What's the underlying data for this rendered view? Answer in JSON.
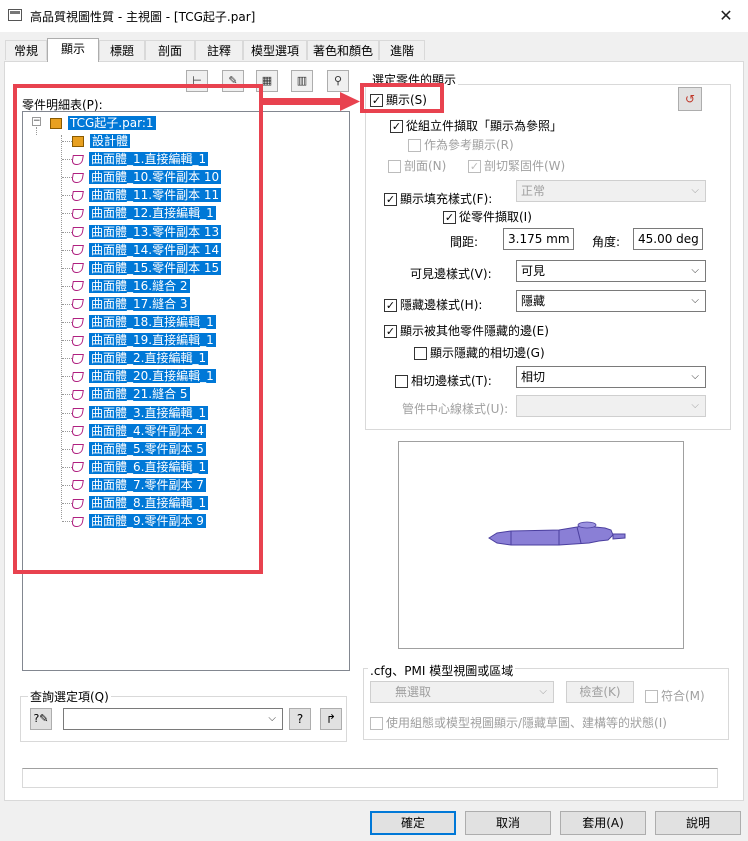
{
  "window": {
    "title": "高品質視圖性質 - 主視圖 - [TCG起子.par]",
    "close": "✕"
  },
  "tabs": [
    "常規",
    "顯示",
    "標題",
    "剖面",
    "註釋",
    "模型選項",
    "著色和顏色",
    "進階"
  ],
  "toolbar_icons": [
    "parts-list-icon",
    "edit-icon",
    "properties-icon",
    "columns-icon",
    "find-icon"
  ],
  "parts_list": {
    "label": "零件明細表(P):",
    "root": "TCG起子.par:1",
    "items": [
      "設計體",
      "曲面體_1.直接編輯_1",
      "曲面體_10.零件副本 10",
      "曲面體_11.零件副本 11",
      "曲面體_12.直接編輯_1",
      "曲面體_13.零件副本 13",
      "曲面體_14.零件副本 14",
      "曲面體_15.零件副本 15",
      "曲面體_16.縫合 2",
      "曲面體_17.縫合 3",
      "曲面體_18.直接編輯_1",
      "曲面體_19.直接編輯_1",
      "曲面體_2.直接編輯_1",
      "曲面體_20.直接編輯_1",
      "曲面體_21.縫合 5",
      "曲面體_3.直接編輯_1",
      "曲面體_4.零件副本 4",
      "曲面體_5.零件副本 5",
      "曲面體_6.直接編輯_1",
      "曲面體_7.零件副本 7",
      "曲面體_8.直接編輯_1",
      "曲面體_9.零件副本 9"
    ]
  },
  "selected_part": {
    "group_title": "選定零件的顯示",
    "show": "顯示(S)",
    "from_assembly": "從組立件擷取「顯示為參照」",
    "as_reference": "作為參考顯示(R)",
    "section": "剖面(N)",
    "section_fasteners": "剖切緊固件(W)",
    "fill_style": "顯示填充樣式(F):",
    "fill_style_value": "正常",
    "from_part": "從零件擷取(I)",
    "spacing_label": "間距:",
    "spacing_value": "3.175 mm",
    "angle_label": "角度:",
    "angle_value": "45.00 deg",
    "visible_edge_label": "可見邊樣式(V):",
    "visible_edge_value": "可見",
    "hidden_edge_label": "隱藏邊樣式(H):",
    "hidden_edge_value": "隱藏",
    "hidden_by_other": "顯示被其他零件隱藏的邊(E)",
    "hidden_tangent": "顯示隱藏的相切邊(G)",
    "tangent_edge_label": "相切邊樣式(T):",
    "tangent_edge_value": "相切",
    "tube_centerline_label": "管件中心線樣式(U):"
  },
  "cfg": {
    "group_title": ".cfg、PMI 模型視圖或區域",
    "select_value": "無選取",
    "check_button": "檢查(K)",
    "match": "符合(M)",
    "use_config": "使用組態或模型視圖顯示/隱藏草圖、建構等的狀態(I)"
  },
  "query": {
    "label": "查詢選定項(Q)",
    "help": "?"
  },
  "buttons": {
    "ok": "確定",
    "cancel": "取消",
    "apply": "套用(A)",
    "help": "說明"
  },
  "colors": {
    "highlight_red": "#e8424f",
    "selection_blue": "#0078d7",
    "model_purple": "#8a7fd6"
  }
}
